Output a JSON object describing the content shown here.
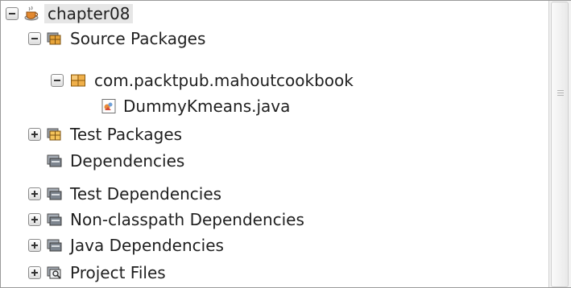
{
  "tree": {
    "root": {
      "label": "chapter08",
      "icon": "project-cup-icon"
    },
    "source_packages": {
      "label": "Source Packages",
      "icon": "source-packages-icon"
    },
    "package": {
      "label": "com.packtpub.mahoutcookbook",
      "icon": "package-icon"
    },
    "java_file": {
      "label": "DummyKmeans.java",
      "icon": "java-file-icon"
    },
    "test_packages": {
      "label": "Test Packages",
      "icon": "test-packages-icon"
    },
    "dependencies": {
      "label": "Dependencies",
      "icon": "library-icon"
    },
    "test_dependencies": {
      "label": "Test Dependencies",
      "icon": "library-icon"
    },
    "nonclasspath_dependencies": {
      "label": "Non-classpath Dependencies",
      "icon": "library-icon"
    },
    "java_dependencies": {
      "label": "Java Dependencies",
      "icon": "library-icon"
    },
    "project_files": {
      "label": "Project Files",
      "icon": "project-files-icon"
    }
  },
  "colors": {
    "selection": "#e6e6e6",
    "package_orange": "#e8a53a",
    "cup_orange": "#e2882e"
  }
}
